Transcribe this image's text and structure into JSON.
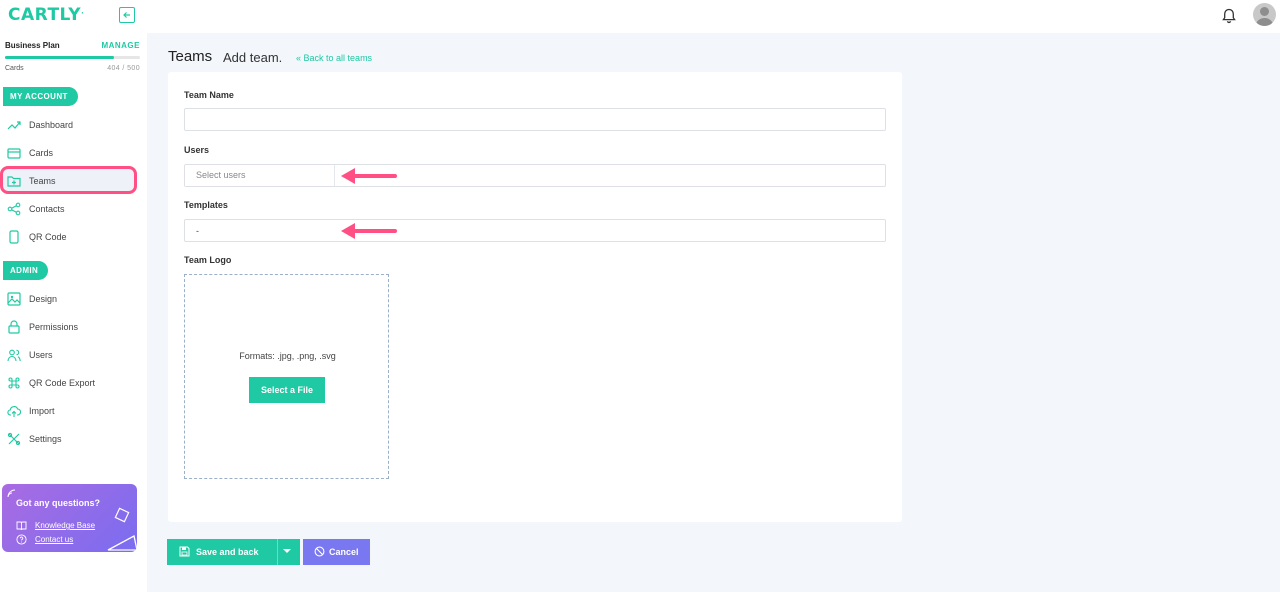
{
  "app": {
    "logo_text": "CARTLY"
  },
  "plan": {
    "name": "Business Plan",
    "manage_label": "MANAGE",
    "cards_label": "Cards",
    "cards_count": "404 / 500",
    "usage_fraction": 0.808
  },
  "sidebar": {
    "my_account_label": "MY ACCOUNT",
    "admin_label": "ADMIN",
    "account_items": [
      {
        "label": "Dashboard",
        "icon": "trend-icon"
      },
      {
        "label": "Cards",
        "icon": "card-icon"
      },
      {
        "label": "Teams",
        "icon": "folder-plus-icon",
        "active": true
      },
      {
        "label": "Contacts",
        "icon": "share-icon"
      },
      {
        "label": "QR Code",
        "icon": "phone-icon"
      }
    ],
    "admin_items": [
      {
        "label": "Design",
        "icon": "image-icon"
      },
      {
        "label": "Permissions",
        "icon": "lock-icon"
      },
      {
        "label": "Users",
        "icon": "users-icon"
      },
      {
        "label": "QR Code Export",
        "icon": "command-icon"
      },
      {
        "label": "Import",
        "icon": "upload-cloud-icon"
      },
      {
        "label": "Settings",
        "icon": "tools-icon"
      }
    ]
  },
  "help": {
    "title": "Got any questions?",
    "knowledge_base": "Knowledge Base",
    "contact_us": "Contact us"
  },
  "header": {
    "title": "Teams",
    "subtitle": "Add team.",
    "back_link": "Back to all teams"
  },
  "form": {
    "team_name_label": "Team Name",
    "team_name_value": "",
    "users_label": "Users",
    "users_placeholder": "Select users",
    "templates_label": "Templates",
    "templates_value": "-",
    "team_logo_label": "Team Logo",
    "formats_text": "Formats: .jpg, .png, .svg",
    "select_file_label": "Select a File"
  },
  "actions": {
    "save_label": "Save and back",
    "cancel_label": "Cancel"
  },
  "colors": {
    "accent": "#1fc9a3",
    "highlight": "#ff4f85",
    "cancel": "#7a78f0"
  }
}
